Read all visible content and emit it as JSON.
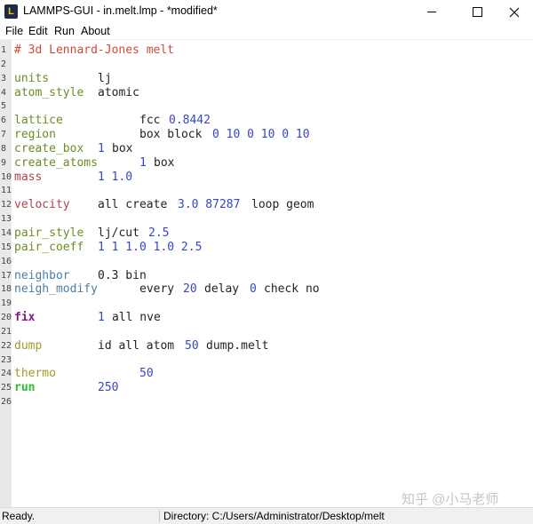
{
  "window": {
    "title": "LAMMPS-GUI - in.melt.lmp - *modified*",
    "app_icon": "L"
  },
  "menu": {
    "items": [
      "File",
      "Edit",
      "Run",
      "About"
    ]
  },
  "editor": {
    "lines": [
      {
        "n": "1",
        "cmd": "# 3d Lennard-Jones melt",
        "args": []
      },
      {
        "n": "2",
        "cmd": "",
        "args": []
      },
      {
        "n": "3",
        "cmd": "units",
        "args": [
          "lj"
        ]
      },
      {
        "n": "4",
        "cmd": "atom_style",
        "args": [
          "atomic"
        ]
      },
      {
        "n": "5",
        "cmd": "",
        "args": []
      },
      {
        "n": "6",
        "cmd": "lattice",
        "args": [
          "fcc",
          "0.8442"
        ]
      },
      {
        "n": "7",
        "cmd": "region",
        "args": [
          "box block",
          "0 10 0 10 0 10"
        ]
      },
      {
        "n": "8",
        "cmd": "create_box",
        "args": [
          "1",
          "box"
        ]
      },
      {
        "n": "9",
        "cmd": "create_atoms",
        "args": [
          "1",
          "box"
        ]
      },
      {
        "n": "10",
        "cmd": "mass",
        "args": [
          "1 1.0"
        ]
      },
      {
        "n": "11",
        "cmd": "",
        "args": []
      },
      {
        "n": "12",
        "cmd": "velocity",
        "args": [
          "all create",
          "3.0 87287",
          "loop geom"
        ]
      },
      {
        "n": "13",
        "cmd": "",
        "args": []
      },
      {
        "n": "14",
        "cmd": "pair_style",
        "args": [
          "lj/cut",
          "2.5"
        ]
      },
      {
        "n": "15",
        "cmd": "pair_coeff",
        "args": [
          "1 1 1.0 1.0 2.5"
        ]
      },
      {
        "n": "16",
        "cmd": "",
        "args": []
      },
      {
        "n": "17",
        "cmd": "neighbor",
        "args": [
          "0.3 bin"
        ]
      },
      {
        "n": "18",
        "cmd": "neigh_modify",
        "args": [
          "every",
          "20",
          "delay",
          "0",
          "check no"
        ]
      },
      {
        "n": "19",
        "cmd": "",
        "args": []
      },
      {
        "n": "20",
        "cmd": "fix",
        "args": [
          "1",
          "all nve"
        ]
      },
      {
        "n": "21",
        "cmd": "",
        "args": []
      },
      {
        "n": "22",
        "cmd": "dump",
        "args": [
          "id all atom",
          "50",
          "dump.melt"
        ]
      },
      {
        "n": "23",
        "cmd": "",
        "args": []
      },
      {
        "n": "24",
        "cmd": "thermo",
        "args": [
          "50"
        ]
      },
      {
        "n": "25",
        "cmd": "run",
        "args": [
          "250"
        ]
      },
      {
        "n": "26",
        "cmd": "",
        "args": []
      }
    ]
  },
  "status": {
    "ready": "Ready.",
    "directory": "Directory: C:/Users/Administrator/Desktop/melt"
  },
  "watermark": "知乎 @小马老师",
  "colors": {
    "comment": "#cf4b37",
    "number": "#3646c8",
    "fix": "#8b158b",
    "run": "#2bbf2b"
  }
}
